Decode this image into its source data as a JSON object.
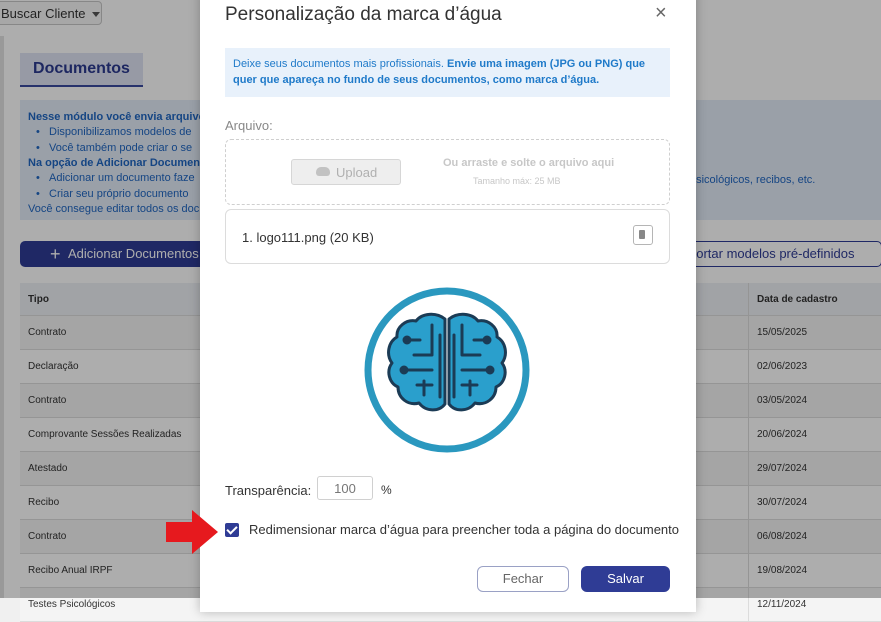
{
  "background": {
    "top_button": "Buscar Cliente",
    "tab": "Documentos",
    "info": {
      "line1_bold": "Nesse módulo você envia arquivos",
      "bullet1": "Disponibilizamos modelos de",
      "bullet2": "Você também pode criar o se",
      "line2_bold": "Na opção de Adicionar Document",
      "bullet3": "Adicionar um documento faze",
      "bullet4": "Criar seu próprio documento",
      "line3": "Você consegue editar todos os doc",
      "right_text": "psicológicos, recibos, etc."
    },
    "add_button": "Adicionar Documentos",
    "import_button": "portar modelos pré-definidos",
    "table": {
      "headers": [
        "Tipo",
        "Data de cadastro"
      ],
      "rows": [
        [
          "Contrato",
          "15/05/2025"
        ],
        [
          "Declaração",
          "02/06/2023"
        ],
        [
          "Contrato",
          "03/05/2024"
        ],
        [
          "Comprovante Sessões Realizadas",
          "20/06/2024"
        ],
        [
          "Atestado",
          "29/07/2024"
        ],
        [
          "Recibo",
          "30/07/2024"
        ],
        [
          "Contrato",
          "06/08/2024"
        ],
        [
          "Recibo Anual IRPF",
          "19/08/2024"
        ],
        [
          "Testes Psicológicos",
          "12/11/2024"
        ]
      ]
    }
  },
  "modal": {
    "title": "Personalização da marca d’água",
    "close": "×",
    "note_normal": "Deixe seus documentos mais profissionais. ",
    "note_bold": "Envie uma imagem (JPG ou PNG) que quer que apareça no fundo de seus documentos, como marca d’água.",
    "file_label": "Arquivo:",
    "upload_button": "Upload",
    "drop_text": "Ou arraste e solte o arquivo aqui",
    "drop_subtext": "Tamanho máx: 25 MB",
    "file_name": "1. logo111.png (20 KB)",
    "transparency_label": "Transparência:",
    "transparency_value": "100",
    "percent": "%",
    "resize_label": "Redimensionar marca d’água para preencher toda a página do documento",
    "resize_checked": true,
    "cancel_button": "Fechar",
    "save_button": "Salvar"
  },
  "colors": {
    "primary": "#2f3c95",
    "watermark_ring": "#2a98bf",
    "watermark_brain": "#2a9fcc",
    "arrow": "#e6191e"
  },
  "icons": [
    "caret-down-icon",
    "plus-icon",
    "close-icon",
    "cloud-upload-icon",
    "trash-icon",
    "brain-logo",
    "checkbox-checked-icon",
    "red-arrow-icon"
  ]
}
